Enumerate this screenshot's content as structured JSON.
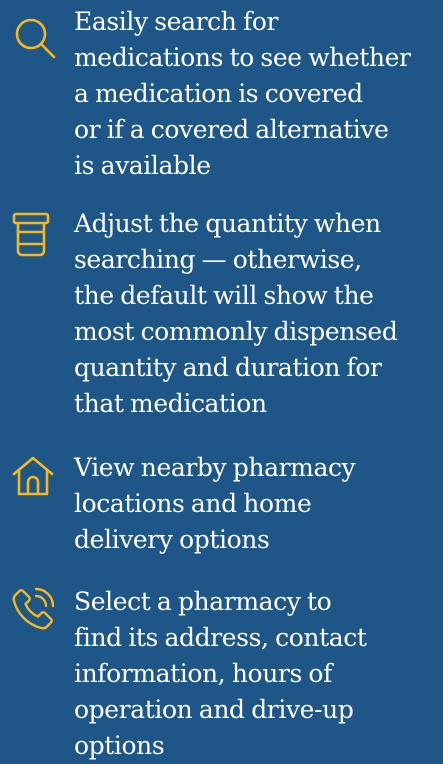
{
  "colors": {
    "background": "#1f5688",
    "accent": "#f5b81f",
    "text": "#ffffff"
  },
  "features": [
    {
      "icon": "search-icon",
      "lines": [
        "Easily search for",
        "medications to see whether",
        "a medication is covered",
        "or if a covered alternative",
        "is available"
      ]
    },
    {
      "icon": "pill-bottle-icon",
      "lines": [
        "Adjust the quantity when",
        "searching — otherwise,",
        "the default will show the",
        "most commonly dispensed",
        "quantity and duration for",
        "that medication"
      ]
    },
    {
      "icon": "home-icon",
      "lines": [
        "View nearby pharmacy",
        "locations and home",
        "delivery options"
      ]
    },
    {
      "icon": "phone-call-icon",
      "lines": [
        "Select a pharmacy to",
        "find its address, contact",
        "information, hours of",
        "operation and drive-up",
        "options"
      ]
    }
  ]
}
